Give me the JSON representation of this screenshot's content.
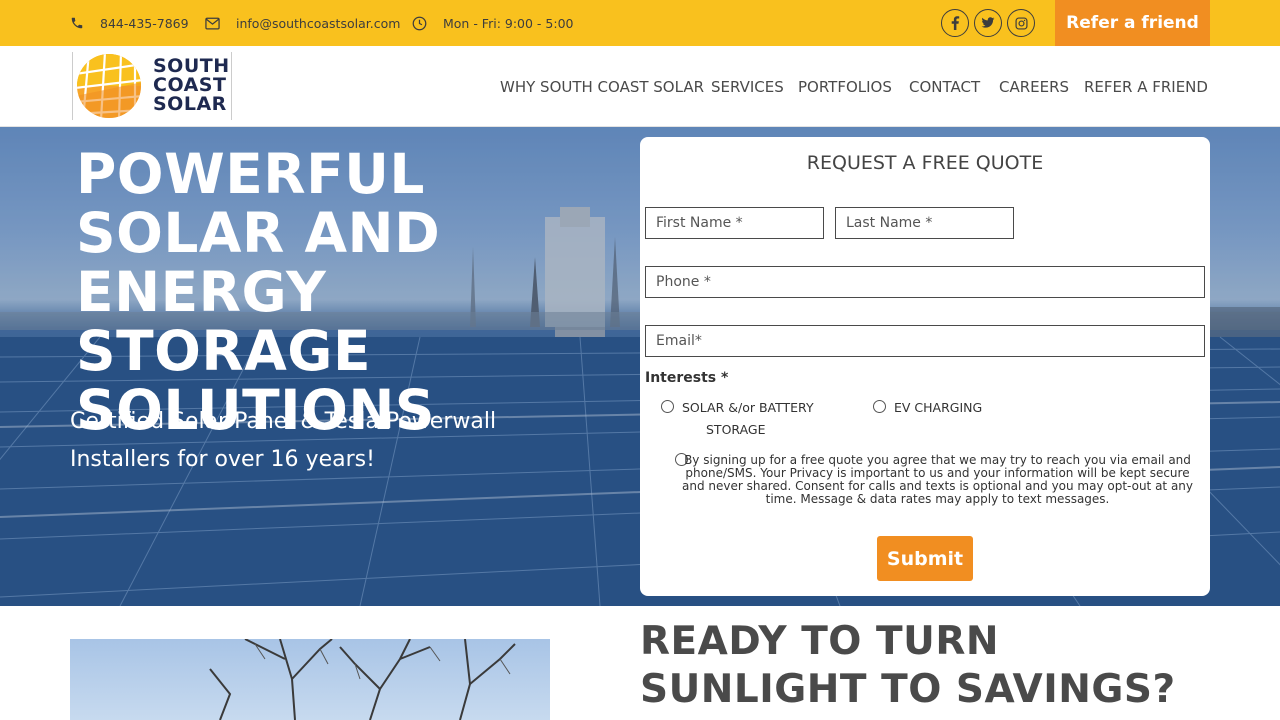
{
  "topbar": {
    "phone": "844-435-7869",
    "email": "info@southcoastsolar.com",
    "hours": "Mon - Fri: 9:00 - 5:00",
    "social": [
      "facebook-icon",
      "twitter-icon",
      "instagram-icon"
    ],
    "refer_label": "Refer a friend"
  },
  "logo": {
    "lines": [
      "SOUTH",
      "COAST",
      "SOLAR"
    ]
  },
  "nav": {
    "items": [
      "WHY SOUTH COAST SOLAR",
      "SERVICES",
      "PORTFOLIOS",
      "CONTACT",
      "CAREERS",
      "REFER A FRIEND"
    ]
  },
  "hero": {
    "title": "POWERFUL SOLAR AND ENERGY STORAGE SOLUTIONS",
    "subtitle": "Certified Solar Panel & Tesla Powerwall Installers for over 16 years!"
  },
  "form": {
    "title": "REQUEST A FREE QUOTE",
    "first_name_placeholder": "First Name *",
    "last_name_placeholder": "Last Name *",
    "phone_placeholder": "Phone *",
    "email_placeholder": "Email*",
    "interests_label": "Interests *",
    "option_solar_line1": "SOLAR &/or BATTERY",
    "option_solar_line2": "STORAGE",
    "option_ev": "EV CHARGING",
    "consent": "By signing up for a free quote you agree that we may try to reach you via email and phone/SMS. Your Privacy is important to us and your information will be kept secure and never shared. Consent for calls and texts is optional and you may opt-out at any time. Message & data rates may apply to text messages.",
    "submit_label": "Submit"
  },
  "section": {
    "heading_line1": "READY TO TURN",
    "heading_line2": "SUNLIGHT TO SAVINGS?"
  },
  "colors": {
    "topbar": "#f9c11e",
    "accent_orange": "#f18e21",
    "navy": "#1e2950"
  }
}
